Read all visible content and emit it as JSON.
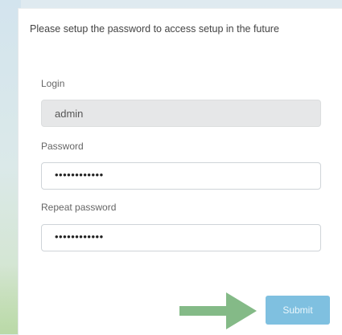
{
  "intro_text": "Please setup the password to access setup in the future",
  "form": {
    "login_label": "Login",
    "login_value": "admin",
    "password_label": "Password",
    "password_mask": "••••••••••••",
    "repeat_label": "Repeat password",
    "repeat_mask": "••••••••••••",
    "submit_label": "Submit"
  },
  "colors": {
    "submit_button": "#7fc0e0",
    "arrow": "#6fae72",
    "panel": "#ffffff",
    "readonly_field": "#e6e7e8"
  },
  "icons": {
    "arrow": "arrow-right-icon"
  }
}
